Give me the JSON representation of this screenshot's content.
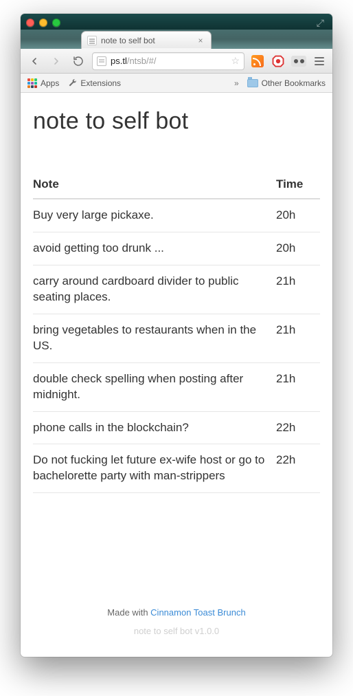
{
  "browser": {
    "tab_title": "note to self bot",
    "url_host": "ps.tl",
    "url_rest": "/ntsb/#/",
    "bookmarks": {
      "apps_label": "Apps",
      "extensions_label": "Extensions",
      "overflow_glyph": "»",
      "other_label": "Other Bookmarks"
    }
  },
  "page": {
    "title": "note to self bot",
    "columns": {
      "note": "Note",
      "time": "Time"
    },
    "notes": [
      {
        "text": "Buy very large pickaxe.",
        "time": "20h"
      },
      {
        "text": "avoid getting too drunk ...",
        "time": "20h"
      },
      {
        "text": "carry around cardboard divider to public seating places.",
        "time": "21h"
      },
      {
        "text": "bring vegetables to restaurants when in the US.",
        "time": "21h"
      },
      {
        "text": "double check spelling when posting after midnight.",
        "time": "21h"
      },
      {
        "text": "phone calls in the blockchain?",
        "time": "22h"
      },
      {
        "text": "Do not fucking let future ex-wife host or go to bachelorette party with man-strippers",
        "time": "22h"
      }
    ],
    "footer": {
      "made_prefix": "Made with ",
      "made_link": "Cinnamon Toast Brunch",
      "version": "note to self bot v1.0.0"
    }
  }
}
